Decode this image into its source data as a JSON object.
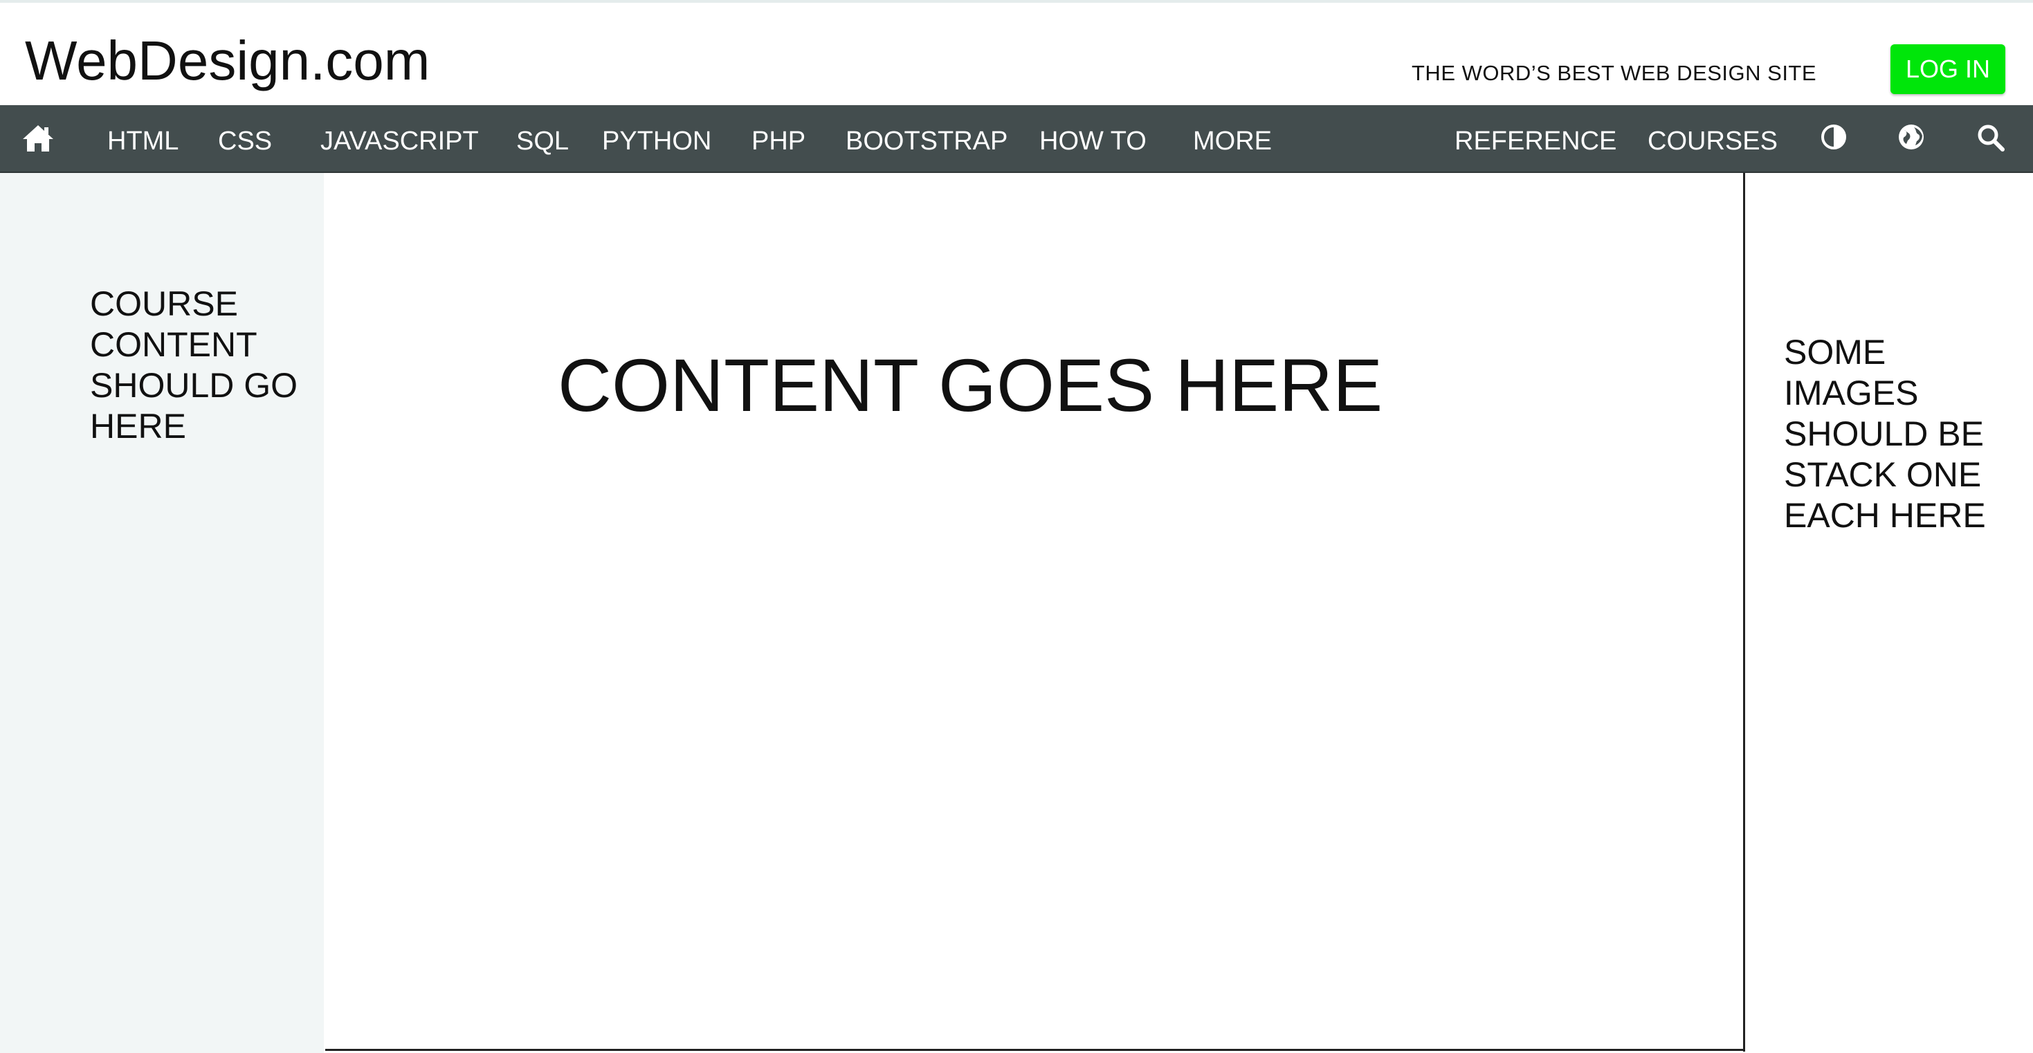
{
  "header": {
    "logo": "WebDesign.com",
    "tagline": "THE WORD’S BEST WEB DESIGN SITE",
    "login_label": "LOG IN"
  },
  "nav": {
    "home_icon": "home-icon",
    "items": [
      "HTML",
      "CSS",
      "JAVASCRIPT",
      "SQL",
      "PYTHON",
      "PHP",
      "BOOTSTRAP",
      "HOW TO",
      "MORE"
    ],
    "right_items": [
      "REFERENCE",
      "COURSES"
    ],
    "icons": [
      "contrast-icon",
      "globe-icon",
      "search-icon"
    ]
  },
  "left_sidebar": {
    "text": "COURSE CONTENT SHOULD GO HERE"
  },
  "main": {
    "text": "CONTENT GOES HERE"
  },
  "right_sidebar": {
    "text": "SOME IMAGES SHOULD BE STACK ONE EACH HERE"
  },
  "colors": {
    "nav_bg": "#434d4e",
    "login_bg": "#00e60a",
    "sidebar_bg": "#f2f6f6"
  }
}
